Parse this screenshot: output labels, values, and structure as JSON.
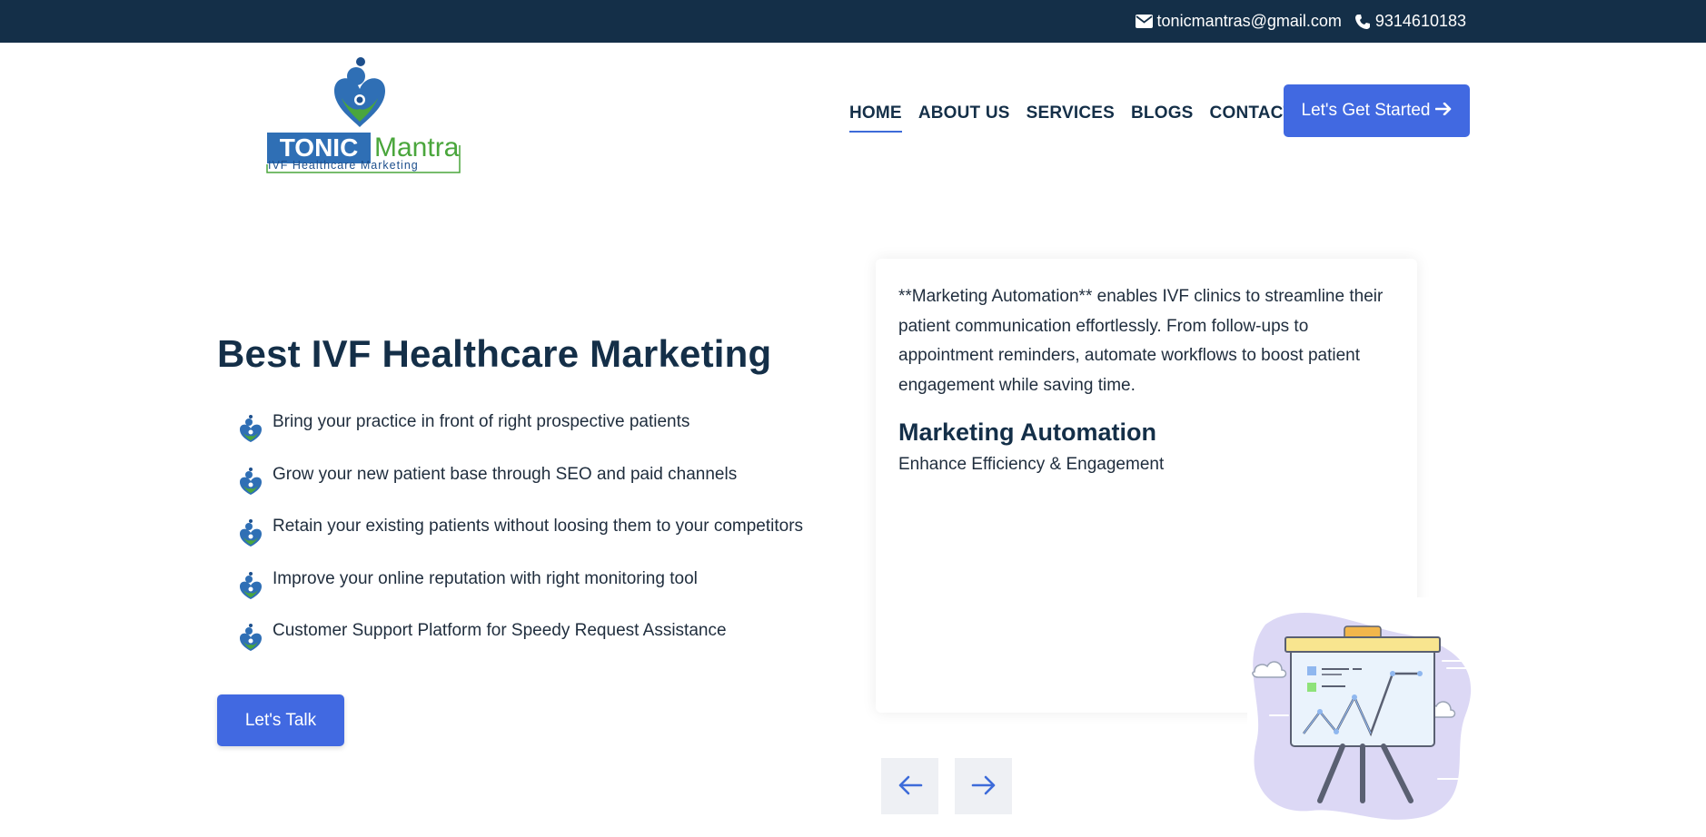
{
  "topbar": {
    "email": "tonicmantras@gmail.com",
    "phone": "9314610183",
    "email_icon": "envelope-icon",
    "phone_icon": "phone-icon"
  },
  "logo": {
    "word_tonic": "TONIC",
    "word_mantra": "Mantra",
    "tagline": "IVF Healthcare Marketing"
  },
  "nav": {
    "items": [
      {
        "label": "HOME",
        "active": true
      },
      {
        "label": "ABOUT US",
        "active": false
      },
      {
        "label": "SERVICES",
        "active": false
      },
      {
        "label": "BLOGS",
        "active": false
      },
      {
        "label": "CONTACT US",
        "active": false
      }
    ]
  },
  "header_cta": {
    "label": "Let's Get Started",
    "icon": "arrow-right-icon"
  },
  "hero": {
    "title": "Best IVF Healthcare Marketing",
    "features": [
      "Bring your practice in front of right prospective patients",
      "Grow your new patient base through SEO and paid channels",
      "Retain your existing patients without loosing them to your competitors",
      "Improve your online reputation with right monitoring tool",
      "Customer Support Platform for Speedy Request Assistance"
    ],
    "button_label": "Let's Talk"
  },
  "slide": {
    "description": "**Marketing Automation** enables IVF clinics to streamline their patient communication effortlessly. From follow-ups to appointment reminders, automate workflows to boost patient engagement while saving time.",
    "heading": "Marketing Automation",
    "subheading": "Enhance Efficiency & Engagement",
    "illustration_icon": "presentation-board-icon"
  },
  "carousel": {
    "prev_icon": "arrow-left-icon",
    "next_icon": "arrow-right-icon"
  },
  "colors": {
    "topbar_bg": "#142f48",
    "primary": "#4169e1",
    "heading": "#142f48",
    "logo_blue": "#2f6fb5",
    "logo_green": "#4aa63c"
  }
}
